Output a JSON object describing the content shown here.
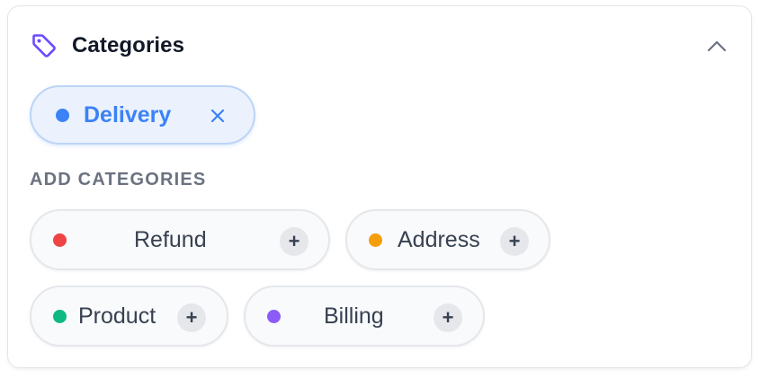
{
  "panel": {
    "title": "Categories",
    "icon": "tag-icon",
    "collapse_icon": "chevron-up-icon",
    "accent_color": "#6d4aff"
  },
  "selected": [
    {
      "label": "Delivery",
      "dot_color": "#3b82f6",
      "remove_icon": "close-icon"
    }
  ],
  "add_section": {
    "label": "ADD CATEGORIES",
    "add_icon": "plus-icon",
    "add_symbol": "+",
    "items": [
      {
        "label": "Refund",
        "dot_color": "#ef4444"
      },
      {
        "label": "Address",
        "dot_color": "#f59e0b"
      },
      {
        "label": "Product",
        "dot_color": "#10b981"
      },
      {
        "label": "Billing",
        "dot_color": "#8b5cf6"
      }
    ]
  }
}
